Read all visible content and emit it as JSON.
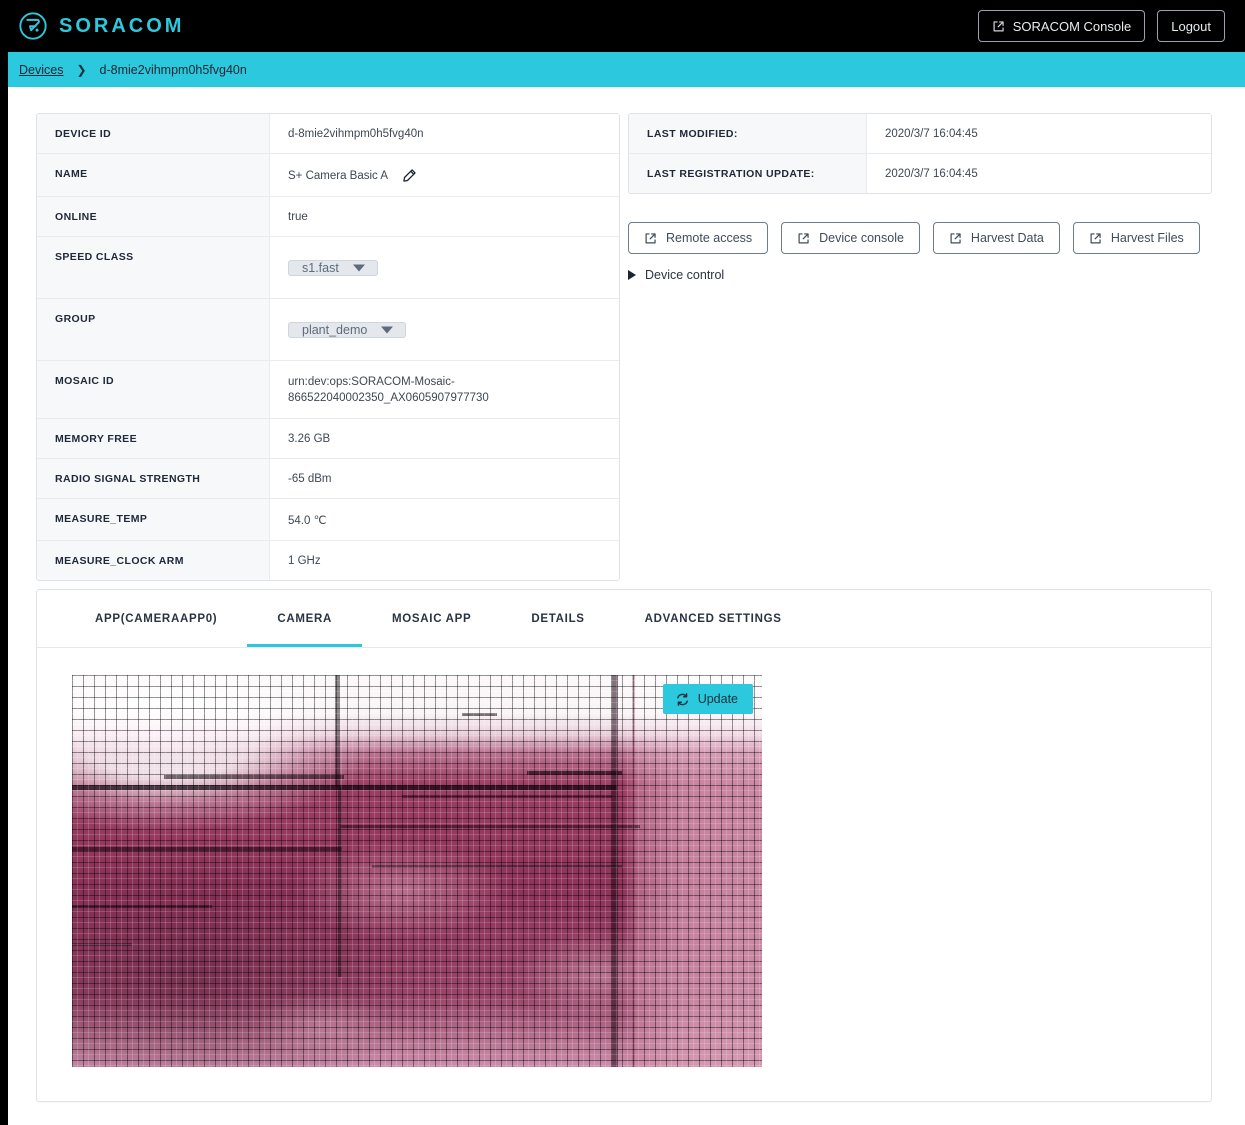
{
  "brand": {
    "name": "SORACOM",
    "logo_icon": "soracom-logo-icon",
    "accent_color": "#2cc8dd"
  },
  "header": {
    "console_button": "SORACOM Console",
    "console_icon": "external-link-icon",
    "logout_button": "Logout"
  },
  "breadcrumb": {
    "root": "Devices",
    "separator": "›",
    "current": "d-8mie2vihmpm0h5fvg40n"
  },
  "device_info": {
    "rows": [
      {
        "key": "DEVICE ID",
        "value": "d-8mie2vihmpm0h5fvg40n",
        "type": "text"
      },
      {
        "key": "NAME",
        "value": "S+ Camera Basic A",
        "type": "editable",
        "edit_icon": "pencil-icon"
      },
      {
        "key": "ONLINE",
        "value": "true",
        "type": "text"
      },
      {
        "key": "SPEED CLASS",
        "value": "s1.fast",
        "type": "select"
      },
      {
        "key": "GROUP",
        "value": "plant_demo",
        "type": "select"
      },
      {
        "key": "MOSAIC ID",
        "value": "urn:dev:ops:SORACOM-Mosaic-866522040002350_AX0605907977730",
        "type": "text"
      },
      {
        "key": "MEMORY FREE",
        "value": "3.26 GB",
        "type": "text"
      },
      {
        "key": "RADIO SIGNAL STRENGTH",
        "value": "-65 dBm",
        "type": "text"
      },
      {
        "key": "MEASURE_TEMP",
        "value": "54.0 ℃",
        "type": "text"
      },
      {
        "key": "MEASURE_CLOCK ARM",
        "value": "1 GHz",
        "type": "text"
      }
    ],
    "speed_class_value": "s1.fast",
    "group_value": "plant_demo",
    "mosaic_id_line1": "urn:dev:ops:SORACOM-Mosaic-",
    "mosaic_id_line2": "866522040002350_AX0605907977730"
  },
  "meta_info": {
    "rows": [
      {
        "key": "LAST MODIFIED:",
        "value": "2020/3/7 16:04:45"
      },
      {
        "key": "LAST REGISTRATION UPDATE:",
        "value": "2020/3/7 16:04:45"
      }
    ]
  },
  "actions": {
    "buttons": [
      {
        "label": "Remote access",
        "icon": "external-link-icon"
      },
      {
        "label": "Device console",
        "icon": "external-link-icon"
      },
      {
        "label": "Harvest Data",
        "icon": "external-link-icon"
      },
      {
        "label": "Harvest Files",
        "icon": "external-link-icon"
      }
    ],
    "device_control": {
      "label": "Device control",
      "icon": "triangle-right-icon",
      "expanded": false
    }
  },
  "tabs": {
    "items": [
      {
        "label": "APP(CAMERAAPP0)",
        "active": false
      },
      {
        "label": "CAMERA",
        "active": true
      },
      {
        "label": "MOSAIC APP",
        "active": false
      },
      {
        "label": "DETAILS",
        "active": false
      },
      {
        "label": "ADVANCED SETTINGS",
        "active": false
      }
    ],
    "active_indicator_color": "#2cc8dd"
  },
  "camera_panel": {
    "update_button": "Update",
    "update_icon": "sync-refresh-icon",
    "update_button_color": "#2cc8dd",
    "image_alt": "pixelated mosaic camera snapshot"
  }
}
